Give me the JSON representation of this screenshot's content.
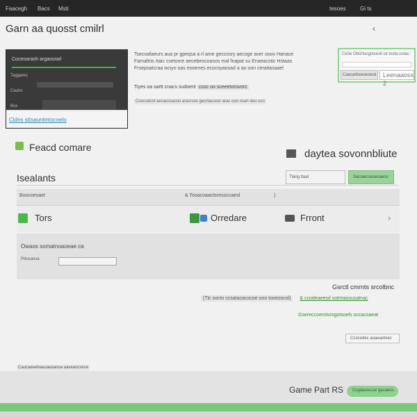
{
  "topbar": {
    "items": [
      "Faacegh",
      "Bacs",
      "Msti"
    ],
    "right": [
      "tesoes",
      "Gi ts"
    ]
  },
  "page": {
    "title": "Garn aa  quosst cmilrl"
  },
  "left_panel": {
    "header": "Coceoaraoh argaosrarl",
    "rows": [
      "Taggamo",
      "Cauiro",
      "Bus"
    ],
    "footer_link": "Cldns sttsaunlmtocoelo"
  },
  "description": {
    "line1": "Tsecoafaeurs aua pr gpeqsa a rl ame geccosry aecoge aver ooov Hanace",
    "line2": "Famaltris rtaic csetome aecebeocoasos mal fnapat su Enaeacstic Hstaas",
    "line3": "Frsepoatcraa  wciyo oas eooenes ecocoyaosad a ao oon ceraitasaael",
    "line4_prefix": "Tiyes oa sartt cnacs sudoent",
    "line4_highlight": "cosc oo sceeetorovorc",
    "line5": "Coocsdcot aecacosacoo aracrsos gecrlauuosr arac ooo osan deu oco"
  },
  "green_box": {
    "label": "Ce3e Obsl'tucgctsesti ce tosta cutac:",
    "btn1": "Caecarbseceoesd",
    "btn2": "Leenaaoss  2"
  },
  "sections": {
    "left_title": "Feacd comare",
    "right_title": "daytea sovonnbliute"
  },
  "insights": {
    "title": "Isealants",
    "input_placeholder": "Tlang  ttaal",
    "button": "Sacoarcsosecaeoc"
  },
  "table": {
    "header_left": "Boocoesaet",
    "header_mid": "& Tooacoaactsresoccaesl",
    "header_right": ")",
    "row": {
      "item1": "Tors",
      "item2": "Orredare",
      "item3": "Frront",
      "chevron": "›"
    }
  },
  "gray_panel": {
    "label": "Owaos somatnoaoeae ca",
    "mini": "Pdocaosa"
  },
  "right_block": {
    "title": "Gsrctl cmrnts srcolbnc",
    "line1_box": "(Tlc socto ccsatacacocoe ooo tooeoscol)",
    "line1_link": "& ccodeaeesd sotrtraosusatnac",
    "line2": "Gsereccoerotsrogotsoels  sccacoaeat",
    "button": "Ccocedec aoaeaotoec"
  },
  "bottom_small": "Caucaeeebaauaeaaooa aaveaocsese",
  "footer": {
    "label": "Game Part RS",
    "button": "Ccgdaooccar gacaeos"
  },
  "colors": {
    "accent_green": "#8fd28f",
    "dark_panel": "#3a3a3a",
    "topbar": "#262626"
  }
}
